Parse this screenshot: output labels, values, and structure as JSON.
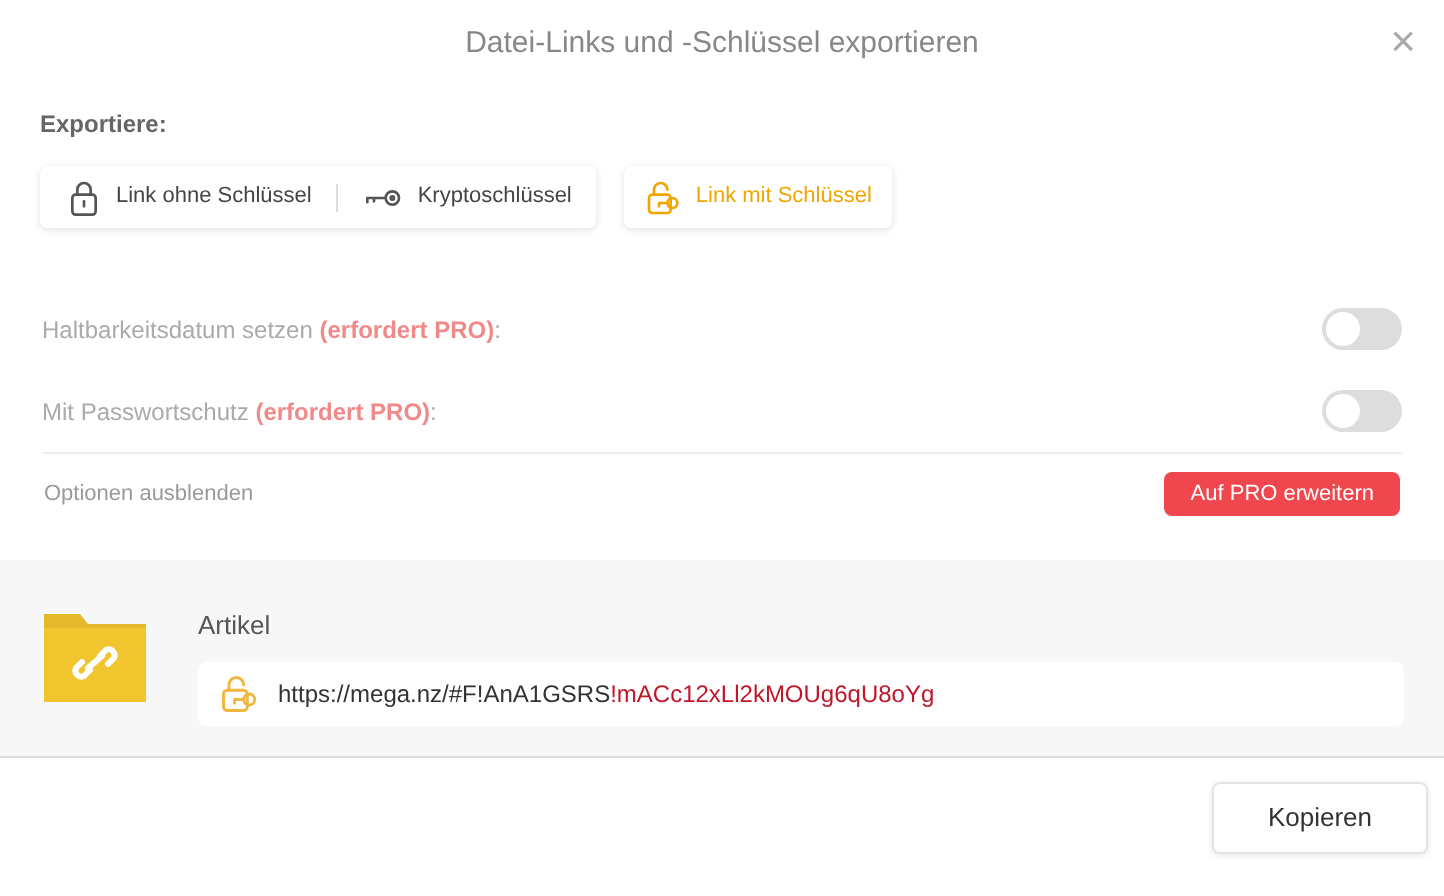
{
  "dialog": {
    "title": "Datei-Links und -Schlüssel exportieren",
    "close": "×"
  },
  "export_label": "Exportiere:",
  "export_options": [
    {
      "label": "Link ohne Schlüssel",
      "selected": false
    },
    {
      "label": "Kryptoschlüssel",
      "selected": false
    },
    {
      "label": "Link mit Schlüssel",
      "selected": true
    }
  ],
  "options": [
    {
      "label": "Haltbarkeitsdatum setzen **(erfordert PRO)**:",
      "on": false
    },
    {
      "label": "Mit Passwortschutz **(erfordert PRO)**:",
      "on": false
    }
  ],
  "hide_options": "Optionen ausblenden",
  "upgrade_button": "Auf PRO erweitern",
  "item": {
    "name": "Artikel",
    "link": "https://mega.nz/#F!AnA1GSRS",
    "key": "!mACc12xLl2kMOUg6qU8oYg"
  },
  "copy_button": "Kopieren"
}
